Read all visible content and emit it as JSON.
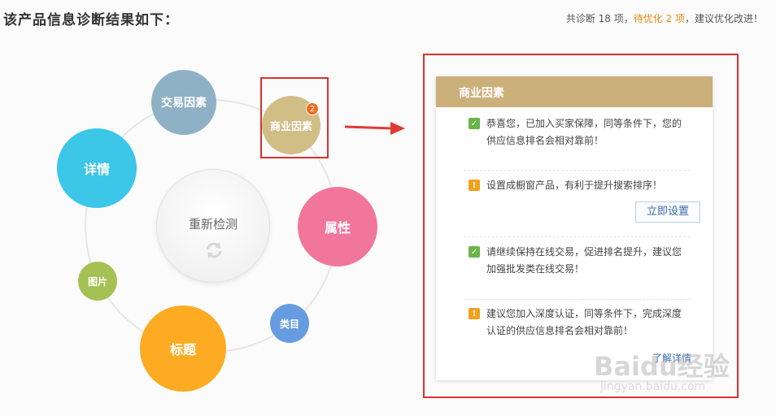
{
  "header": {
    "title": "该产品信息诊断结果如下：",
    "summary_prefix": "共诊断 18 项，",
    "summary_pending": "待优化 2 项",
    "summary_suffix": "，建议优化改进！"
  },
  "diagnosis": {
    "center_label": "重新检测",
    "trade": "交易因素",
    "business": "商业因素",
    "business_badge": "2",
    "detail": "详情",
    "attribute": "属性",
    "image": "图片",
    "category": "类目",
    "title": "标题"
  },
  "panel": {
    "title": "商业因素",
    "items": [
      {
        "status": "ok",
        "text": "恭喜您，已加入买家保障，同等条件下，您的供应信息排名会相对靠前！"
      },
      {
        "status": "warn",
        "text": "设置成橱窗产品，有利于提升搜索排序！",
        "action": "立即设置"
      },
      {
        "status": "ok",
        "text": "请继续保持在线交易，促进排名提升，建议您加强批发类在线交易！"
      },
      {
        "status": "warn",
        "text": "建议您加入深度认证，同等条件下，完成深度认证的供应信息排名会相对靠前！",
        "link": "了解详情"
      }
    ]
  },
  "watermark": {
    "main": "Baidu经验",
    "sub": "jingyan.baidu.com"
  },
  "colors": {
    "highlight": "#d9332e",
    "panel_header": "#cbb07a",
    "ok": "#6ab44a",
    "warn": "#f0a21c"
  }
}
